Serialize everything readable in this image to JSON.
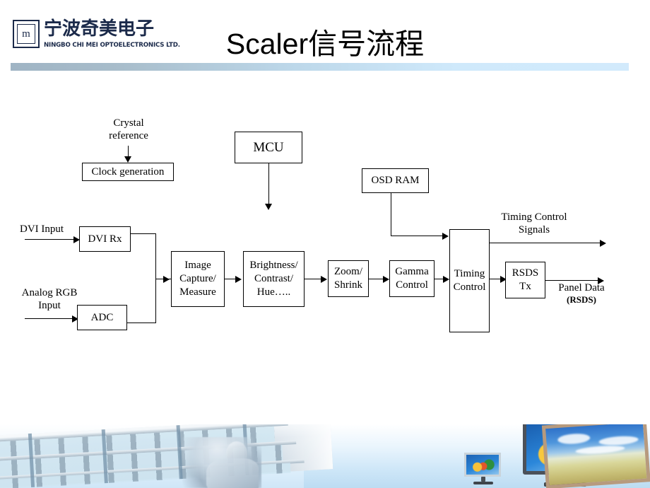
{
  "header": {
    "title": "Scaler信号流程",
    "logo": {
      "mark_glyph": "m",
      "company_cn": "宁波奇美电子",
      "company_en": "NINGBO CHI MEI OPTOELECTRONICS LTD."
    }
  },
  "diagram": {
    "boxes": {
      "clock_generation": "Clock generation",
      "mcu": "MCU",
      "osd_ram": "OSD RAM",
      "dvi_rx": "DVI Rx",
      "adc": "ADC",
      "image_capture_l1": "Image",
      "image_capture_l2": "Capture/",
      "image_capture_l3": "Measure",
      "brightness_l1": "Brightness/",
      "brightness_l2": "Contrast/",
      "brightness_l3": "Hue…..",
      "zoom_shrink_l1": "Zoom/",
      "zoom_shrink_l2": "Shrink",
      "gamma_control_l1": "Gamma",
      "gamma_control_l2": "Control",
      "timing_control_l1": "Timing",
      "timing_control_l2": "Control",
      "rsds_tx_l1": "RSDS",
      "rsds_tx_l2": "Tx"
    },
    "labels": {
      "crystal_reference_l1": "Crystal",
      "crystal_reference_l2": "reference",
      "dvi_input": "DVI Input",
      "analog_rgb_l1": "Analog RGB",
      "analog_rgb_l2": "Input",
      "timing_signals_l1": "Timing  Control",
      "timing_signals_l2": "Signals",
      "panel_data_l1": "Panel Data",
      "panel_data_l2": "(RSDS)"
    }
  }
}
